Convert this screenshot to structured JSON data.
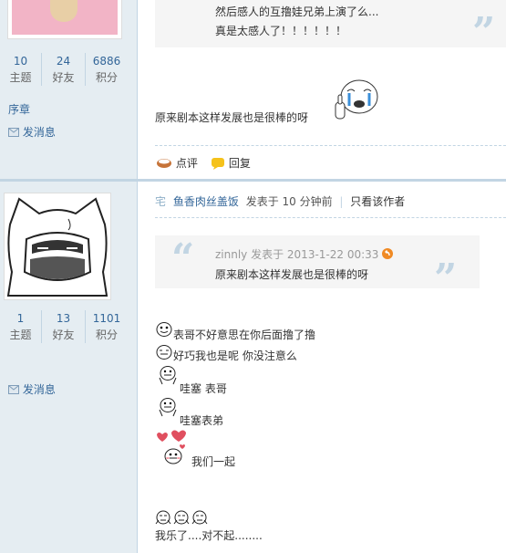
{
  "post1": {
    "stats": [
      {
        "value": "10",
        "label": "主题"
      },
      {
        "value": "24",
        "label": "好友"
      },
      {
        "value": "6886",
        "label": "积分"
      }
    ],
    "rank": "序章",
    "send_msg": "发消息",
    "quote_lines": [
      "然后感人的互撸娃兄弟上演了么...",
      "真是太感人了！！！！！！"
    ],
    "body": "原来剧本这样发展也是很棒的呀",
    "actions": {
      "rate": "点评",
      "reply": "回复"
    }
  },
  "post2": {
    "author": "鱼香肉丝盖饭",
    "posted": "发表于 10 分钟前",
    "only_author": "只看该作者",
    "stats": [
      {
        "value": "1",
        "label": "主题"
      },
      {
        "value": "13",
        "label": "好友"
      },
      {
        "value": "1101",
        "label": "积分"
      }
    ],
    "send_msg": "发消息",
    "quote_head": "zinnly 发表于 2013-1-22 00:33",
    "quote_body": "原来剧本这样发展也是很棒的呀",
    "lines": [
      "表哥不好意思在你后面撸了撸",
      "好巧我也是呢 你没注意么",
      "哇塞 表哥",
      "哇塞表弟",
      "我们一起",
      "我乐了....对不起........"
    ]
  }
}
